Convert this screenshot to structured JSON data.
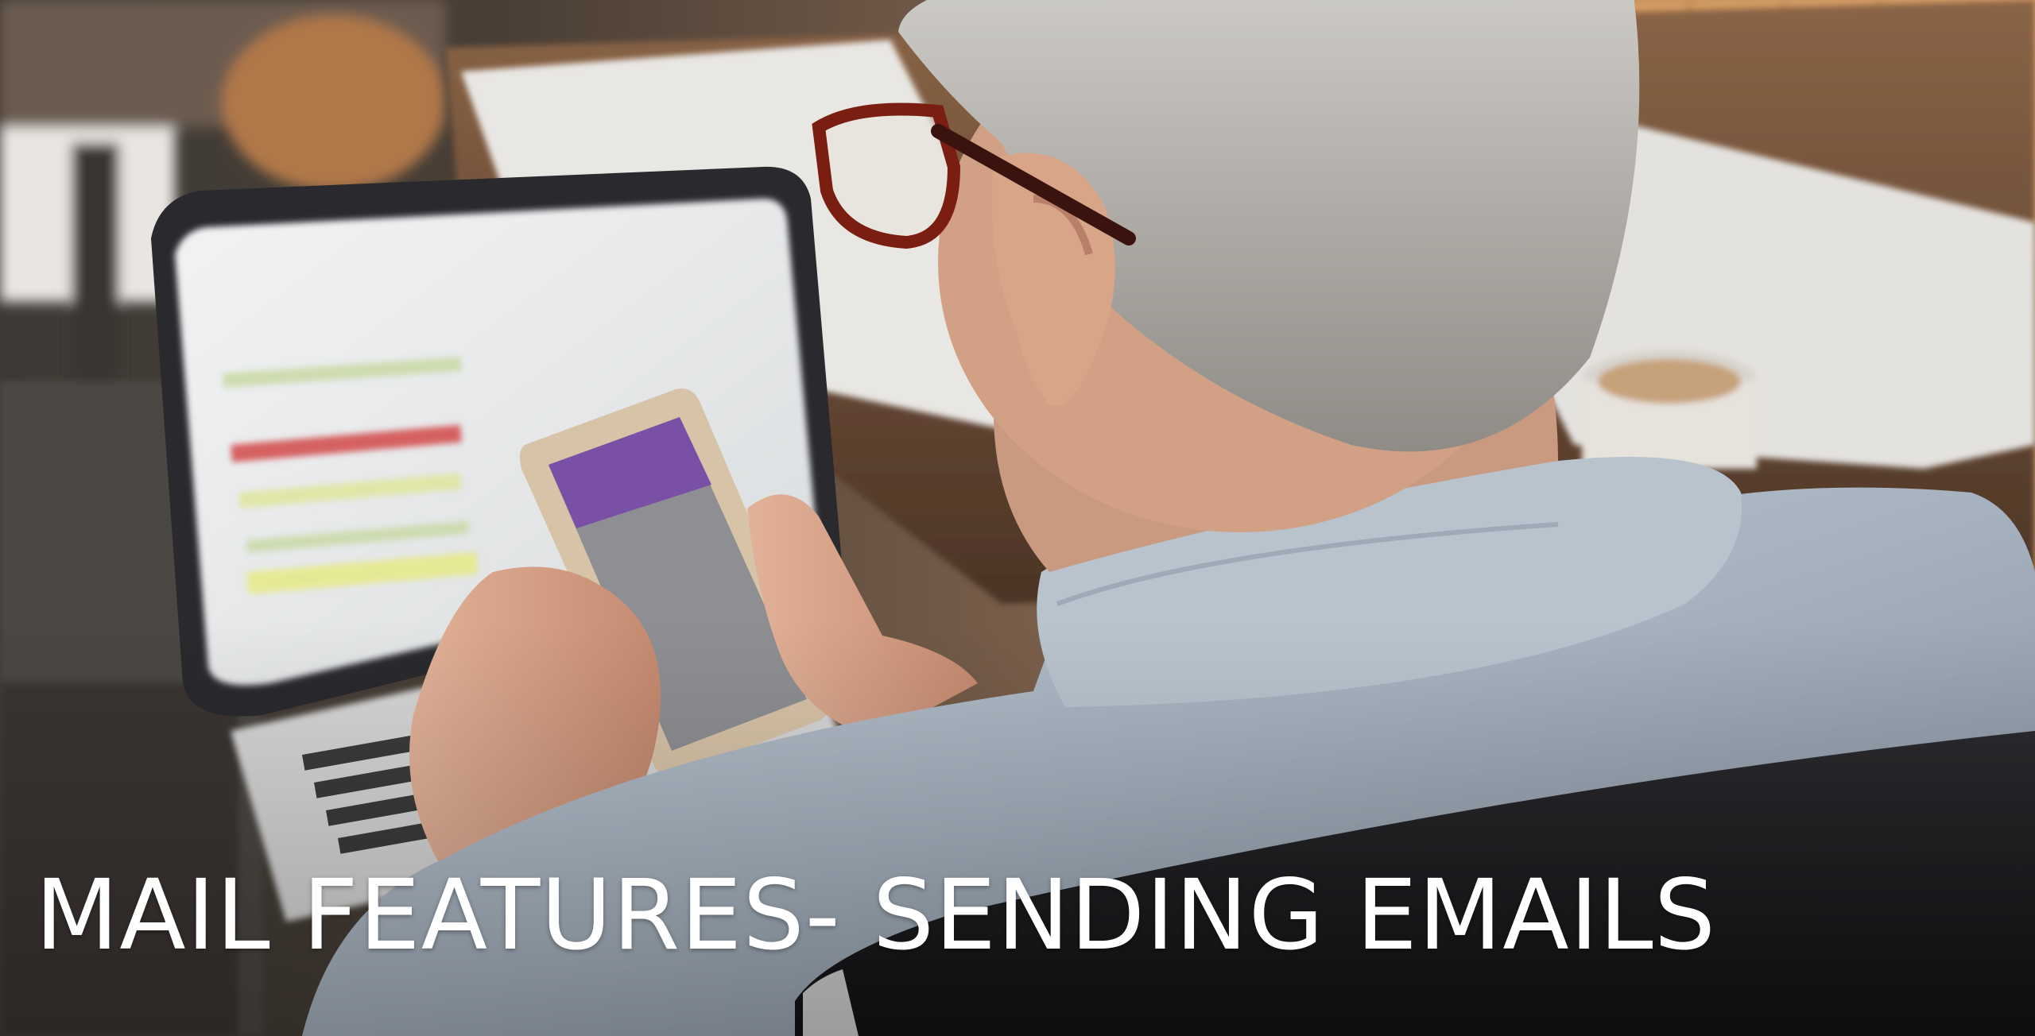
{
  "slide": {
    "title": "MAIL FEATURES- SENDING EMAILS"
  },
  "photo": {
    "subject": "man-with-glasses-using-phone-and-laptop"
  },
  "colors": {
    "title_text": "#ffffff",
    "shirt": "#a9b6c4",
    "hair": "#b9b7b1",
    "skin": "#d9a58a",
    "glasses_frame": "#7a1e12",
    "chair": "#1c1c1f",
    "desk": "#6f4f38",
    "wall": "#d8a46a"
  }
}
